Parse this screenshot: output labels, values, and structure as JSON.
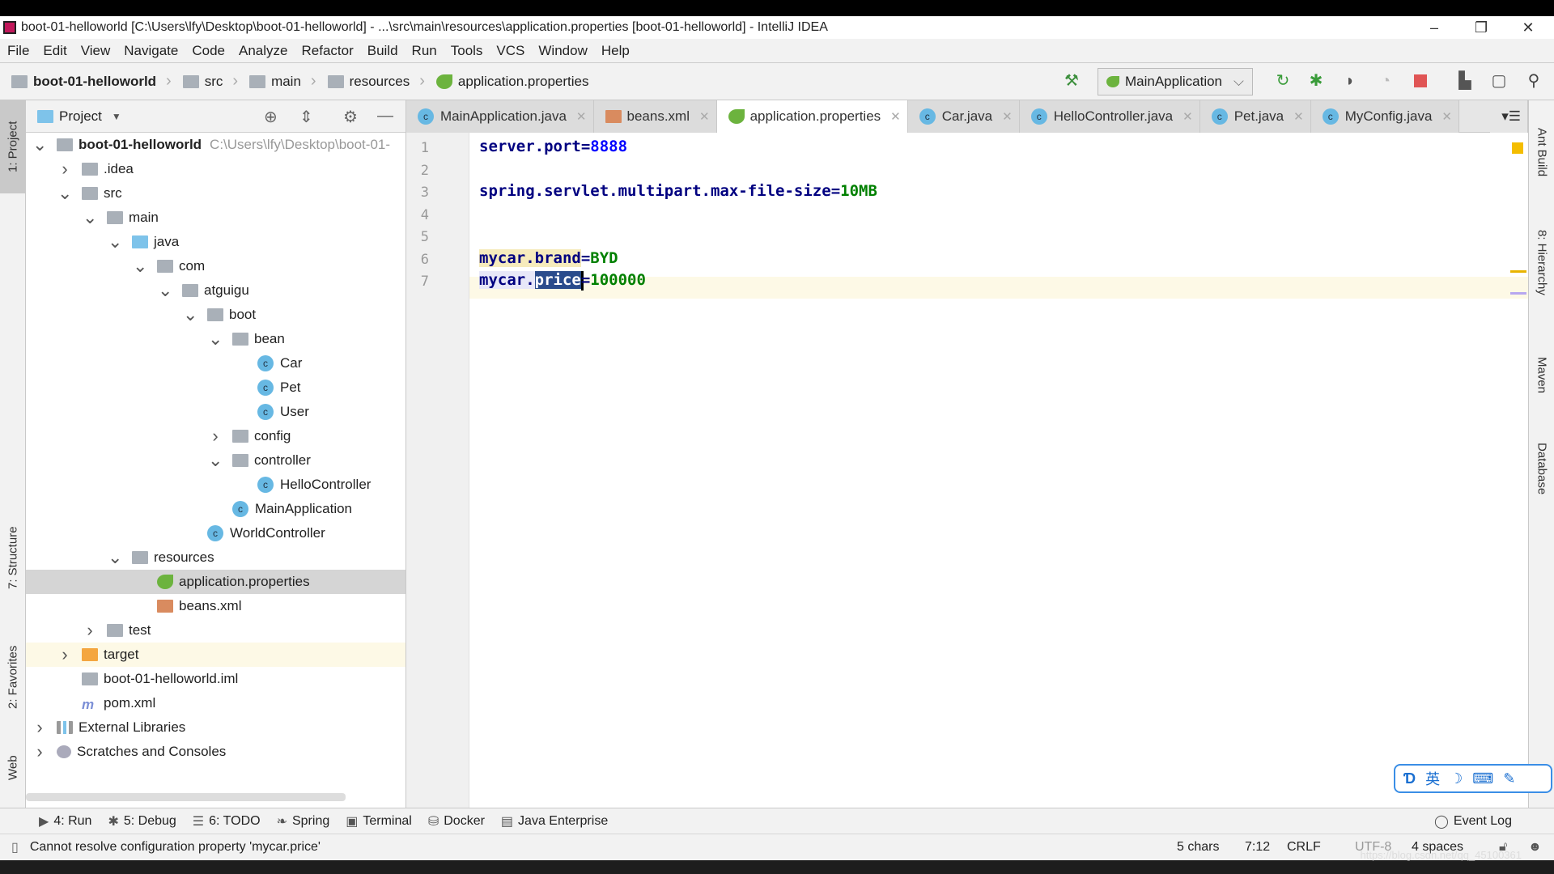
{
  "window": {
    "title": "boot-01-helloworld [C:\\Users\\lfy\\Desktop\\boot-01-helloworld] - ...\\src\\main\\resources\\application.properties [boot-01-helloworld] - IntelliJ IDEA",
    "minimize": "–",
    "restore": "❐",
    "close": "✕"
  },
  "menu": [
    "File",
    "Edit",
    "View",
    "Navigate",
    "Code",
    "Analyze",
    "Refactor",
    "Build",
    "Run",
    "Tools",
    "VCS",
    "Window",
    "Help"
  ],
  "breadcrumb": [
    "boot-01-helloworld",
    "src",
    "main",
    "resources",
    "application.properties"
  ],
  "toolbar": {
    "run_config": "MainApplication"
  },
  "left_strip": {
    "project": "1: Project",
    "structure": "7: Structure",
    "favorites": "2: Favorites",
    "web": "Web"
  },
  "project_panel": {
    "title": "Project",
    "tree": [
      {
        "label": "boot-01-helloworld",
        "hint": "C:\\Users\\lfy\\Desktop\\boot-01-",
        "level": 0,
        "arrow": "down",
        "icon": "module",
        "bold": true
      },
      {
        "label": ".idea",
        "level": 1,
        "arrow": "right",
        "icon": "folder"
      },
      {
        "label": "src",
        "level": 1,
        "arrow": "down",
        "icon": "folder"
      },
      {
        "label": "main",
        "level": 2,
        "arrow": "down",
        "icon": "folder"
      },
      {
        "label": "java",
        "level": 3,
        "arrow": "down",
        "icon": "folder-blue"
      },
      {
        "label": "com",
        "level": 4,
        "arrow": "down",
        "icon": "package"
      },
      {
        "label": "atguigu",
        "level": 5,
        "arrow": "down",
        "icon": "package"
      },
      {
        "label": "boot",
        "level": 6,
        "arrow": "down",
        "icon": "package"
      },
      {
        "label": "bean",
        "level": 7,
        "arrow": "down",
        "icon": "package"
      },
      {
        "label": "Car",
        "level": 8,
        "icon": "class"
      },
      {
        "label": "Pet",
        "level": 8,
        "icon": "class"
      },
      {
        "label": "User",
        "level": 8,
        "icon": "class"
      },
      {
        "label": "config",
        "level": 7,
        "arrow": "right",
        "icon": "package"
      },
      {
        "label": "controller",
        "level": 7,
        "arrow": "down",
        "icon": "package"
      },
      {
        "label": "HelloController",
        "level": 8,
        "icon": "class"
      },
      {
        "label": "MainApplication",
        "level": 7,
        "icon": "spring-class"
      },
      {
        "label": "WorldController",
        "level": 6,
        "icon": "class"
      },
      {
        "label": "resources",
        "level": 3,
        "arrow": "down",
        "icon": "folder"
      },
      {
        "label": "application.properties",
        "level": 4,
        "icon": "spring",
        "selected": true
      },
      {
        "label": "beans.xml",
        "level": 4,
        "icon": "xml"
      },
      {
        "label": "test",
        "level": 2,
        "arrow": "right",
        "icon": "folder"
      },
      {
        "label": "target",
        "level": 1,
        "arrow": "right",
        "icon": "folder-orange",
        "highlight": true
      },
      {
        "label": "boot-01-helloworld.iml",
        "level": 1,
        "icon": "iml"
      },
      {
        "label": "pom.xml",
        "level": 1,
        "icon": "maven"
      },
      {
        "label": "External Libraries",
        "level": 0,
        "arrow": "right",
        "icon": "library"
      },
      {
        "label": "Scratches and Consoles",
        "level": 0,
        "arrow": "right",
        "icon": "scratch"
      }
    ]
  },
  "tabs": [
    {
      "label": "MainApplication.java",
      "icon": "spring-class"
    },
    {
      "label": "beans.xml",
      "icon": "xml"
    },
    {
      "label": "application.properties",
      "icon": "spring",
      "active": true
    },
    {
      "label": "Car.java",
      "icon": "class"
    },
    {
      "label": "HelloController.java",
      "icon": "class"
    },
    {
      "label": "Pet.java",
      "icon": "class"
    },
    {
      "label": "MyConfig.java",
      "icon": "class"
    }
  ],
  "editor": {
    "lines": [
      {
        "n": "1",
        "key": "server.port",
        "eq": "=",
        "val": "8888",
        "valtype": "number"
      },
      {
        "n": "2"
      },
      {
        "n": "3",
        "key": "spring.servlet.multipart.max-file-size",
        "eq": "=",
        "val": "10MB"
      },
      {
        "n": "4"
      },
      {
        "n": "5"
      },
      {
        "n": "6",
        "key": "mycar.brand",
        "eq": "=",
        "val": "BYD"
      },
      {
        "n": "7",
        "key": "mycar.",
        "sel": "price",
        "eq": "=",
        "val": "100000",
        "current": true
      }
    ]
  },
  "right_strip": [
    "Ant Build",
    "8: Hierarchy",
    "Maven",
    "Database"
  ],
  "tool_windows": [
    {
      "icon": "▶",
      "label": "4: Run"
    },
    {
      "icon": "✱",
      "label": "5: Debug"
    },
    {
      "icon": "☰",
      "label": "6: TODO"
    },
    {
      "icon": "❧",
      "label": "Spring"
    },
    {
      "icon": "▣",
      "label": "Terminal"
    },
    {
      "icon": "⛁",
      "label": "Docker"
    },
    {
      "icon": "▤",
      "label": "Java Enterprise"
    }
  ],
  "event_log": "Event Log",
  "status": {
    "message": "Cannot resolve configuration property 'mycar.price'",
    "selection": "5 chars",
    "position": "7:12",
    "line_sep": "CRLF",
    "encoding": "UTF-8",
    "indent": "4 spaces"
  },
  "ime": {
    "lang": "英"
  },
  "watermark": "https://blog.csdn.net/qq_45100361"
}
